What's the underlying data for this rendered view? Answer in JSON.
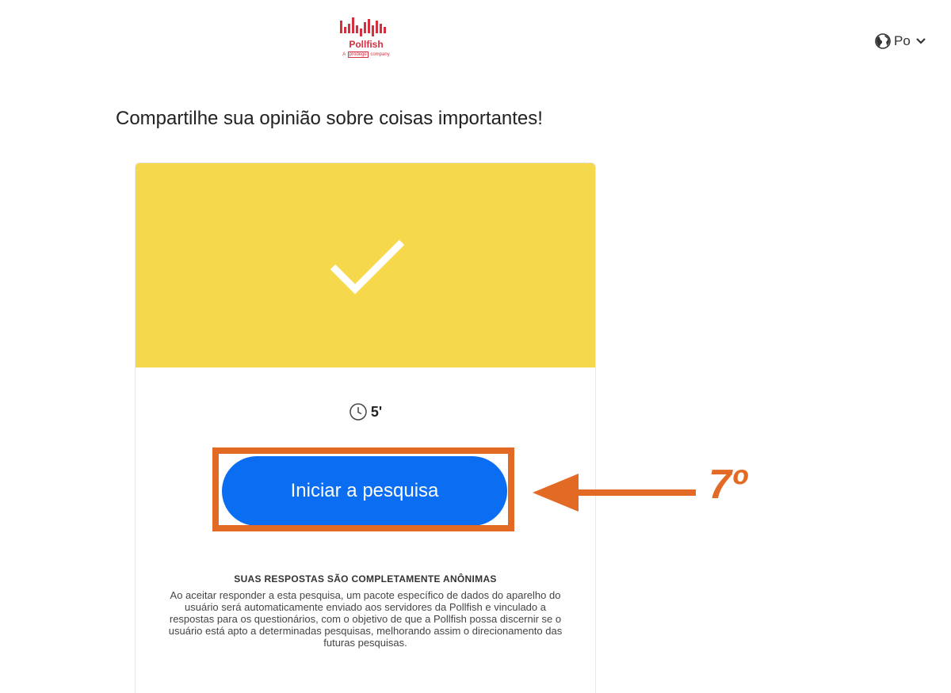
{
  "header": {
    "logo_name": "Pollfish",
    "logo_sub_prefix": "A",
    "logo_sub_brand": "prodege",
    "logo_sub_suffix": "company",
    "language": "Po",
    "globe_icon": "globe-icon",
    "chevron_icon": "chevron-down-icon"
  },
  "main": {
    "headline": "Compartilhe sua opinião sobre coisas importantes!"
  },
  "card": {
    "banner_color": "#f6d84c",
    "check_icon": "checkmark-icon",
    "clock_icon": "clock-icon",
    "duration": "5'",
    "start_button": "Iniciar a pesquisa",
    "button_color": "#0b6df2",
    "anon_title": "SUAS RESPOSTAS SÃO COMPLETAMENTE ANÔNIMAS",
    "anon_body": "Ao aceitar responder a esta pesquisa, um pacote específico de dados do aparelho do usuário será automaticamente enviado aos servidores da Pollfish e vinculado a respostas para os questionários, com o objetivo de que a Pollfish possa discernir se o usuário está apto a determinadas pesquisas, melhorando assim o direcionamento das futuras pesquisas."
  },
  "annotation": {
    "step": "7º",
    "color": "#e36a24"
  }
}
